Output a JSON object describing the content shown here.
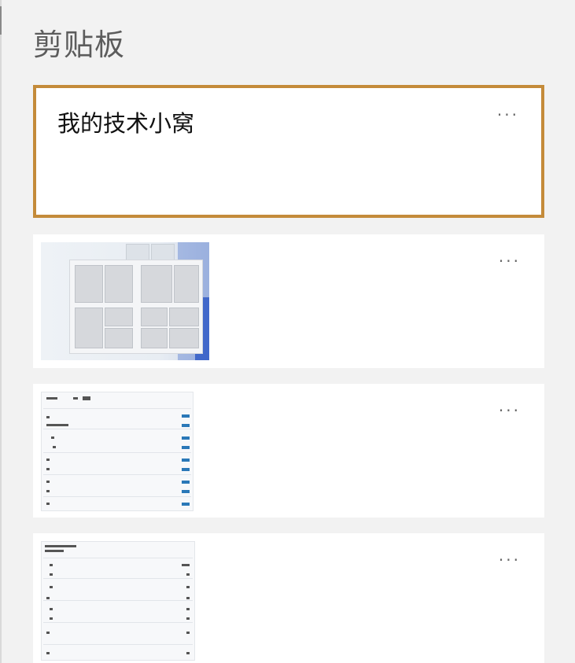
{
  "panel": {
    "title": "剪贴板"
  },
  "items": [
    {
      "type": "text",
      "text": "我的技术小窝",
      "more_label": "···",
      "selected": true
    },
    {
      "type": "image",
      "thumbnail": "snap-layouts-screenshot",
      "more_label": "···"
    },
    {
      "type": "image",
      "thumbnail": "list-screenshot",
      "more_label": "···"
    },
    {
      "type": "image",
      "thumbnail": "list-screenshot",
      "more_label": "···"
    }
  ],
  "colors": {
    "background": "#f2f2f2",
    "card": "#ffffff",
    "selected_border": "#c48b3a",
    "title_text": "#5c5c5c"
  }
}
